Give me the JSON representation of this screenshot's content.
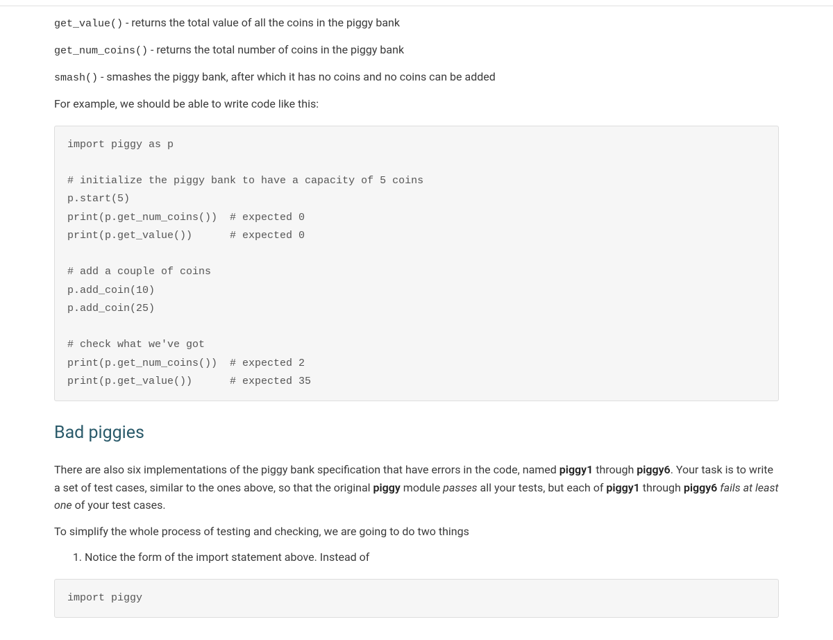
{
  "methods": {
    "get_value": {
      "sig": "get_value()",
      "desc": " - returns the total value of all the coins in the piggy bank"
    },
    "get_num_coins": {
      "sig": "get_num_coins()",
      "desc": " - returns the total number of coins in the piggy bank"
    },
    "smash": {
      "sig": "smash()",
      "desc": " - smashes the piggy bank, after which it has no coins and no coins can be added"
    }
  },
  "example_intro": "For example, we should be able to write code like this:",
  "code_example": "import piggy as p\n\n# initialize the piggy bank to have a capacity of 5 coins\np.start(5)\nprint(p.get_num_coins())  # expected 0\nprint(p.get_value())      # expected 0\n\n# add a couple of coins\np.add_coin(10)\np.add_coin(25)\n\n# check what we've got\nprint(p.get_num_coins())  # expected 2\nprint(p.get_value())      # expected 35",
  "section": {
    "heading": "Bad piggies"
  },
  "bad_piggies": {
    "t1": "There are also six implementations of the piggy bank specification that have errors in the code, named ",
    "b1": "piggy1",
    "t2": " through ",
    "b2": "piggy6",
    "t3": ". Your task is to write a set of test cases, similar to the ones above, so that the original ",
    "b3": "piggy",
    "t4": " module ",
    "i1": "passes",
    "t5": " all your tests, but each of ",
    "b4": "piggy1",
    "t6": " through ",
    "b5": "piggy6",
    "t7": " ",
    "i2": "fails at least one",
    "t8": " of your test cases."
  },
  "simplify_intro": "To simplify the whole process of testing and checking, we are going to do two things",
  "list": {
    "item1": "Notice the form of the import statement above. Instead of"
  },
  "code_import": "import piggy"
}
